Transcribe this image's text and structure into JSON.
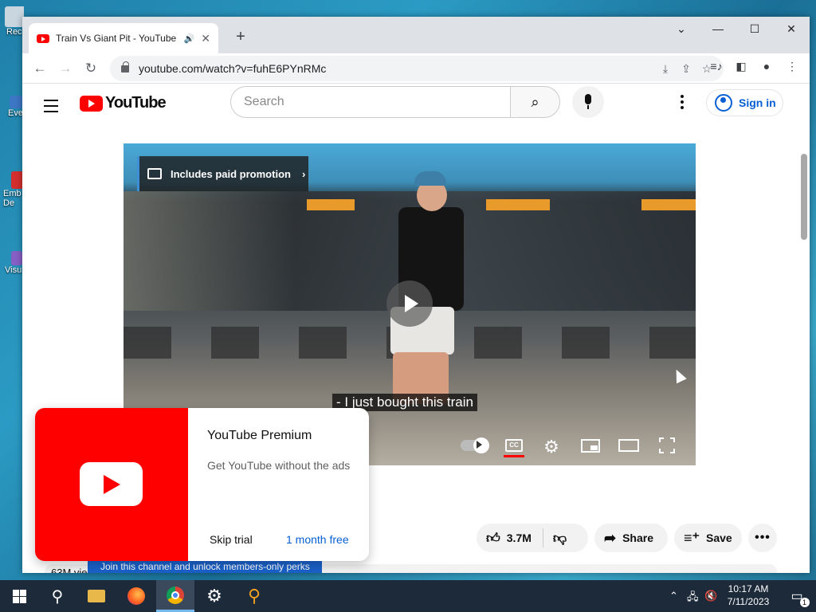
{
  "desktop": {
    "icons": [
      {
        "label": "Rec"
      },
      {
        "label": "Eve"
      },
      {
        "label": "Emb De"
      },
      {
        "label": "Visu"
      }
    ]
  },
  "browser": {
    "tab": {
      "title": "Train Vs Giant Pit - YouTube"
    },
    "url": "youtube.com/watch?v=fuhE6PYnRMc",
    "window_controls": {
      "dropdown": "⌄",
      "minimize": "—",
      "maximize": "☐",
      "close": "✕"
    }
  },
  "youtube": {
    "logo_text": "YouTube",
    "search_placeholder": "Search",
    "signin_label": "Sign in",
    "player": {
      "paid_promotion": "Includes paid promotion",
      "caption": "- I just bought this train",
      "cc_label": "CC"
    },
    "actions": {
      "likes": "3.7M",
      "share": "Share",
      "save": "Save",
      "more": "•••"
    },
    "views_partial": "63M vie",
    "join_banner": "Join this channel and unlock members-only perks"
  },
  "premium_popup": {
    "title": "YouTube Premium",
    "subtitle": "Get YouTube without the ads",
    "skip": "Skip trial",
    "cta": "1 month free"
  },
  "taskbar": {
    "time": "10:17 AM",
    "date": "7/11/2023",
    "notification_count": "1"
  },
  "colors": {
    "youtube_red": "#ff0000",
    "link_blue": "#065fd4",
    "taskbar": "#1c2a3a"
  }
}
